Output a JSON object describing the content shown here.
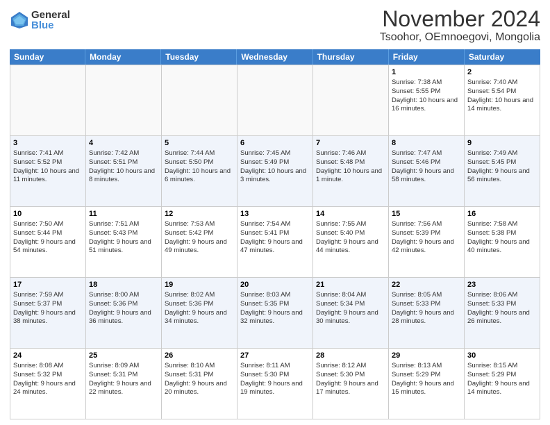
{
  "logo": {
    "general": "General",
    "blue": "Blue"
  },
  "title": "November 2024",
  "location": "Tsoohor, OEmnoegovi, Mongolia",
  "days_header": [
    "Sunday",
    "Monday",
    "Tuesday",
    "Wednesday",
    "Thursday",
    "Friday",
    "Saturday"
  ],
  "weeks": [
    [
      {
        "day": "",
        "sunrise": "",
        "sunset": "",
        "daylight": "",
        "empty": true
      },
      {
        "day": "",
        "sunrise": "",
        "sunset": "",
        "daylight": "",
        "empty": true
      },
      {
        "day": "",
        "sunrise": "",
        "sunset": "",
        "daylight": "",
        "empty": true
      },
      {
        "day": "",
        "sunrise": "",
        "sunset": "",
        "daylight": "",
        "empty": true
      },
      {
        "day": "",
        "sunrise": "",
        "sunset": "",
        "daylight": "",
        "empty": true
      },
      {
        "day": "1",
        "sunrise": "Sunrise: 7:38 AM",
        "sunset": "Sunset: 5:55 PM",
        "daylight": "Daylight: 10 hours and 16 minutes."
      },
      {
        "day": "2",
        "sunrise": "Sunrise: 7:40 AM",
        "sunset": "Sunset: 5:54 PM",
        "daylight": "Daylight: 10 hours and 14 minutes."
      }
    ],
    [
      {
        "day": "3",
        "sunrise": "Sunrise: 7:41 AM",
        "sunset": "Sunset: 5:52 PM",
        "daylight": "Daylight: 10 hours and 11 minutes."
      },
      {
        "day": "4",
        "sunrise": "Sunrise: 7:42 AM",
        "sunset": "Sunset: 5:51 PM",
        "daylight": "Daylight: 10 hours and 8 minutes."
      },
      {
        "day": "5",
        "sunrise": "Sunrise: 7:44 AM",
        "sunset": "Sunset: 5:50 PM",
        "daylight": "Daylight: 10 hours and 6 minutes."
      },
      {
        "day": "6",
        "sunrise": "Sunrise: 7:45 AM",
        "sunset": "Sunset: 5:49 PM",
        "daylight": "Daylight: 10 hours and 3 minutes."
      },
      {
        "day": "7",
        "sunrise": "Sunrise: 7:46 AM",
        "sunset": "Sunset: 5:48 PM",
        "daylight": "Daylight: 10 hours and 1 minute."
      },
      {
        "day": "8",
        "sunrise": "Sunrise: 7:47 AM",
        "sunset": "Sunset: 5:46 PM",
        "daylight": "Daylight: 9 hours and 58 minutes."
      },
      {
        "day": "9",
        "sunrise": "Sunrise: 7:49 AM",
        "sunset": "Sunset: 5:45 PM",
        "daylight": "Daylight: 9 hours and 56 minutes."
      }
    ],
    [
      {
        "day": "10",
        "sunrise": "Sunrise: 7:50 AM",
        "sunset": "Sunset: 5:44 PM",
        "daylight": "Daylight: 9 hours and 54 minutes."
      },
      {
        "day": "11",
        "sunrise": "Sunrise: 7:51 AM",
        "sunset": "Sunset: 5:43 PM",
        "daylight": "Daylight: 9 hours and 51 minutes."
      },
      {
        "day": "12",
        "sunrise": "Sunrise: 7:53 AM",
        "sunset": "Sunset: 5:42 PM",
        "daylight": "Daylight: 9 hours and 49 minutes."
      },
      {
        "day": "13",
        "sunrise": "Sunrise: 7:54 AM",
        "sunset": "Sunset: 5:41 PM",
        "daylight": "Daylight: 9 hours and 47 minutes."
      },
      {
        "day": "14",
        "sunrise": "Sunrise: 7:55 AM",
        "sunset": "Sunset: 5:40 PM",
        "daylight": "Daylight: 9 hours and 44 minutes."
      },
      {
        "day": "15",
        "sunrise": "Sunrise: 7:56 AM",
        "sunset": "Sunset: 5:39 PM",
        "daylight": "Daylight: 9 hours and 42 minutes."
      },
      {
        "day": "16",
        "sunrise": "Sunrise: 7:58 AM",
        "sunset": "Sunset: 5:38 PM",
        "daylight": "Daylight: 9 hours and 40 minutes."
      }
    ],
    [
      {
        "day": "17",
        "sunrise": "Sunrise: 7:59 AM",
        "sunset": "Sunset: 5:37 PM",
        "daylight": "Daylight: 9 hours and 38 minutes."
      },
      {
        "day": "18",
        "sunrise": "Sunrise: 8:00 AM",
        "sunset": "Sunset: 5:36 PM",
        "daylight": "Daylight: 9 hours and 36 minutes."
      },
      {
        "day": "19",
        "sunrise": "Sunrise: 8:02 AM",
        "sunset": "Sunset: 5:36 PM",
        "daylight": "Daylight: 9 hours and 34 minutes."
      },
      {
        "day": "20",
        "sunrise": "Sunrise: 8:03 AM",
        "sunset": "Sunset: 5:35 PM",
        "daylight": "Daylight: 9 hours and 32 minutes."
      },
      {
        "day": "21",
        "sunrise": "Sunrise: 8:04 AM",
        "sunset": "Sunset: 5:34 PM",
        "daylight": "Daylight: 9 hours and 30 minutes."
      },
      {
        "day": "22",
        "sunrise": "Sunrise: 8:05 AM",
        "sunset": "Sunset: 5:33 PM",
        "daylight": "Daylight: 9 hours and 28 minutes."
      },
      {
        "day": "23",
        "sunrise": "Sunrise: 8:06 AM",
        "sunset": "Sunset: 5:33 PM",
        "daylight": "Daylight: 9 hours and 26 minutes."
      }
    ],
    [
      {
        "day": "24",
        "sunrise": "Sunrise: 8:08 AM",
        "sunset": "Sunset: 5:32 PM",
        "daylight": "Daylight: 9 hours and 24 minutes."
      },
      {
        "day": "25",
        "sunrise": "Sunrise: 8:09 AM",
        "sunset": "Sunset: 5:31 PM",
        "daylight": "Daylight: 9 hours and 22 minutes."
      },
      {
        "day": "26",
        "sunrise": "Sunrise: 8:10 AM",
        "sunset": "Sunset: 5:31 PM",
        "daylight": "Daylight: 9 hours and 20 minutes."
      },
      {
        "day": "27",
        "sunrise": "Sunrise: 8:11 AM",
        "sunset": "Sunset: 5:30 PM",
        "daylight": "Daylight: 9 hours and 19 minutes."
      },
      {
        "day": "28",
        "sunrise": "Sunrise: 8:12 AM",
        "sunset": "Sunset: 5:30 PM",
        "daylight": "Daylight: 9 hours and 17 minutes."
      },
      {
        "day": "29",
        "sunrise": "Sunrise: 8:13 AM",
        "sunset": "Sunset: 5:29 PM",
        "daylight": "Daylight: 9 hours and 15 minutes."
      },
      {
        "day": "30",
        "sunrise": "Sunrise: 8:15 AM",
        "sunset": "Sunset: 5:29 PM",
        "daylight": "Daylight: 9 hours and 14 minutes."
      }
    ]
  ]
}
